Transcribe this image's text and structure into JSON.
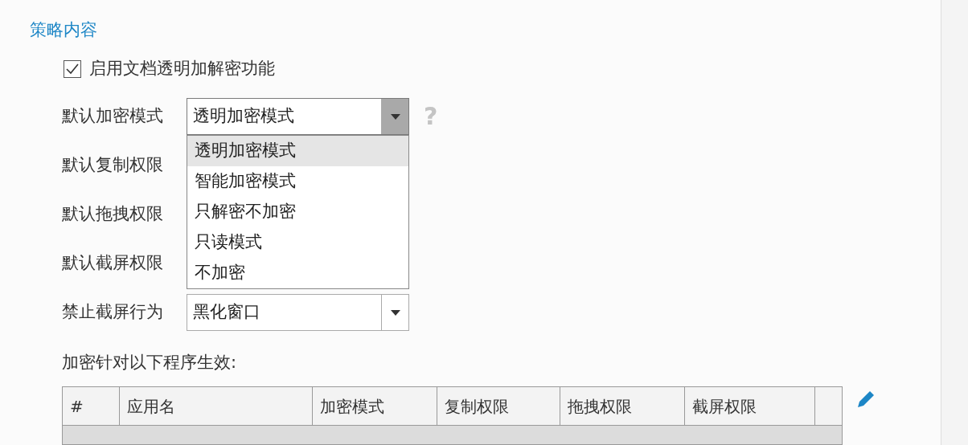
{
  "section_title": "策略内容",
  "enable_option": {
    "label": "启用文档透明加解密功能",
    "checked": true
  },
  "fields": [
    {
      "label": "默认加密模式",
      "kind": "dropdown",
      "value": "透明加密模式",
      "help_icon": "?",
      "expanded": true,
      "options": [
        {
          "label": "透明加密模式",
          "selected": true
        },
        {
          "label": "智能加密模式",
          "selected": false
        },
        {
          "label": "只解密不加密",
          "selected": false
        },
        {
          "label": "只读模式",
          "selected": false
        },
        {
          "label": "不加密",
          "selected": false
        }
      ]
    },
    {
      "label": "默认复制权限",
      "kind": "covered"
    },
    {
      "label": "默认拖拽权限",
      "kind": "covered"
    },
    {
      "label": "默认截屏权限",
      "kind": "covered"
    },
    {
      "label": "禁止截屏行为",
      "kind": "dropdown",
      "value": "黑化窗口",
      "expanded": false
    }
  ],
  "table": {
    "caption": "加密针对以下程序生效:",
    "columns": [
      "#",
      "应用名",
      "加密模式",
      "复制权限",
      "拖拽权限",
      "截屏权限"
    ]
  }
}
